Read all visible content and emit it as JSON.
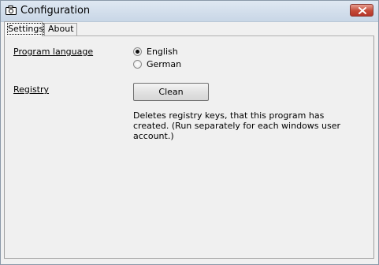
{
  "window": {
    "title": "Configuration"
  },
  "tabs": [
    {
      "label": "Settings",
      "active": true
    },
    {
      "label": "About",
      "active": false
    }
  ],
  "settings": {
    "language_label": "Program language",
    "languages": [
      {
        "label": "English",
        "selected": true
      },
      {
        "label": "German",
        "selected": false
      }
    ],
    "registry_label": "Registry",
    "clean_button": "Clean",
    "registry_description": "Deletes registry keys, that this program has created. (Run separately for each windows user account.)"
  }
}
